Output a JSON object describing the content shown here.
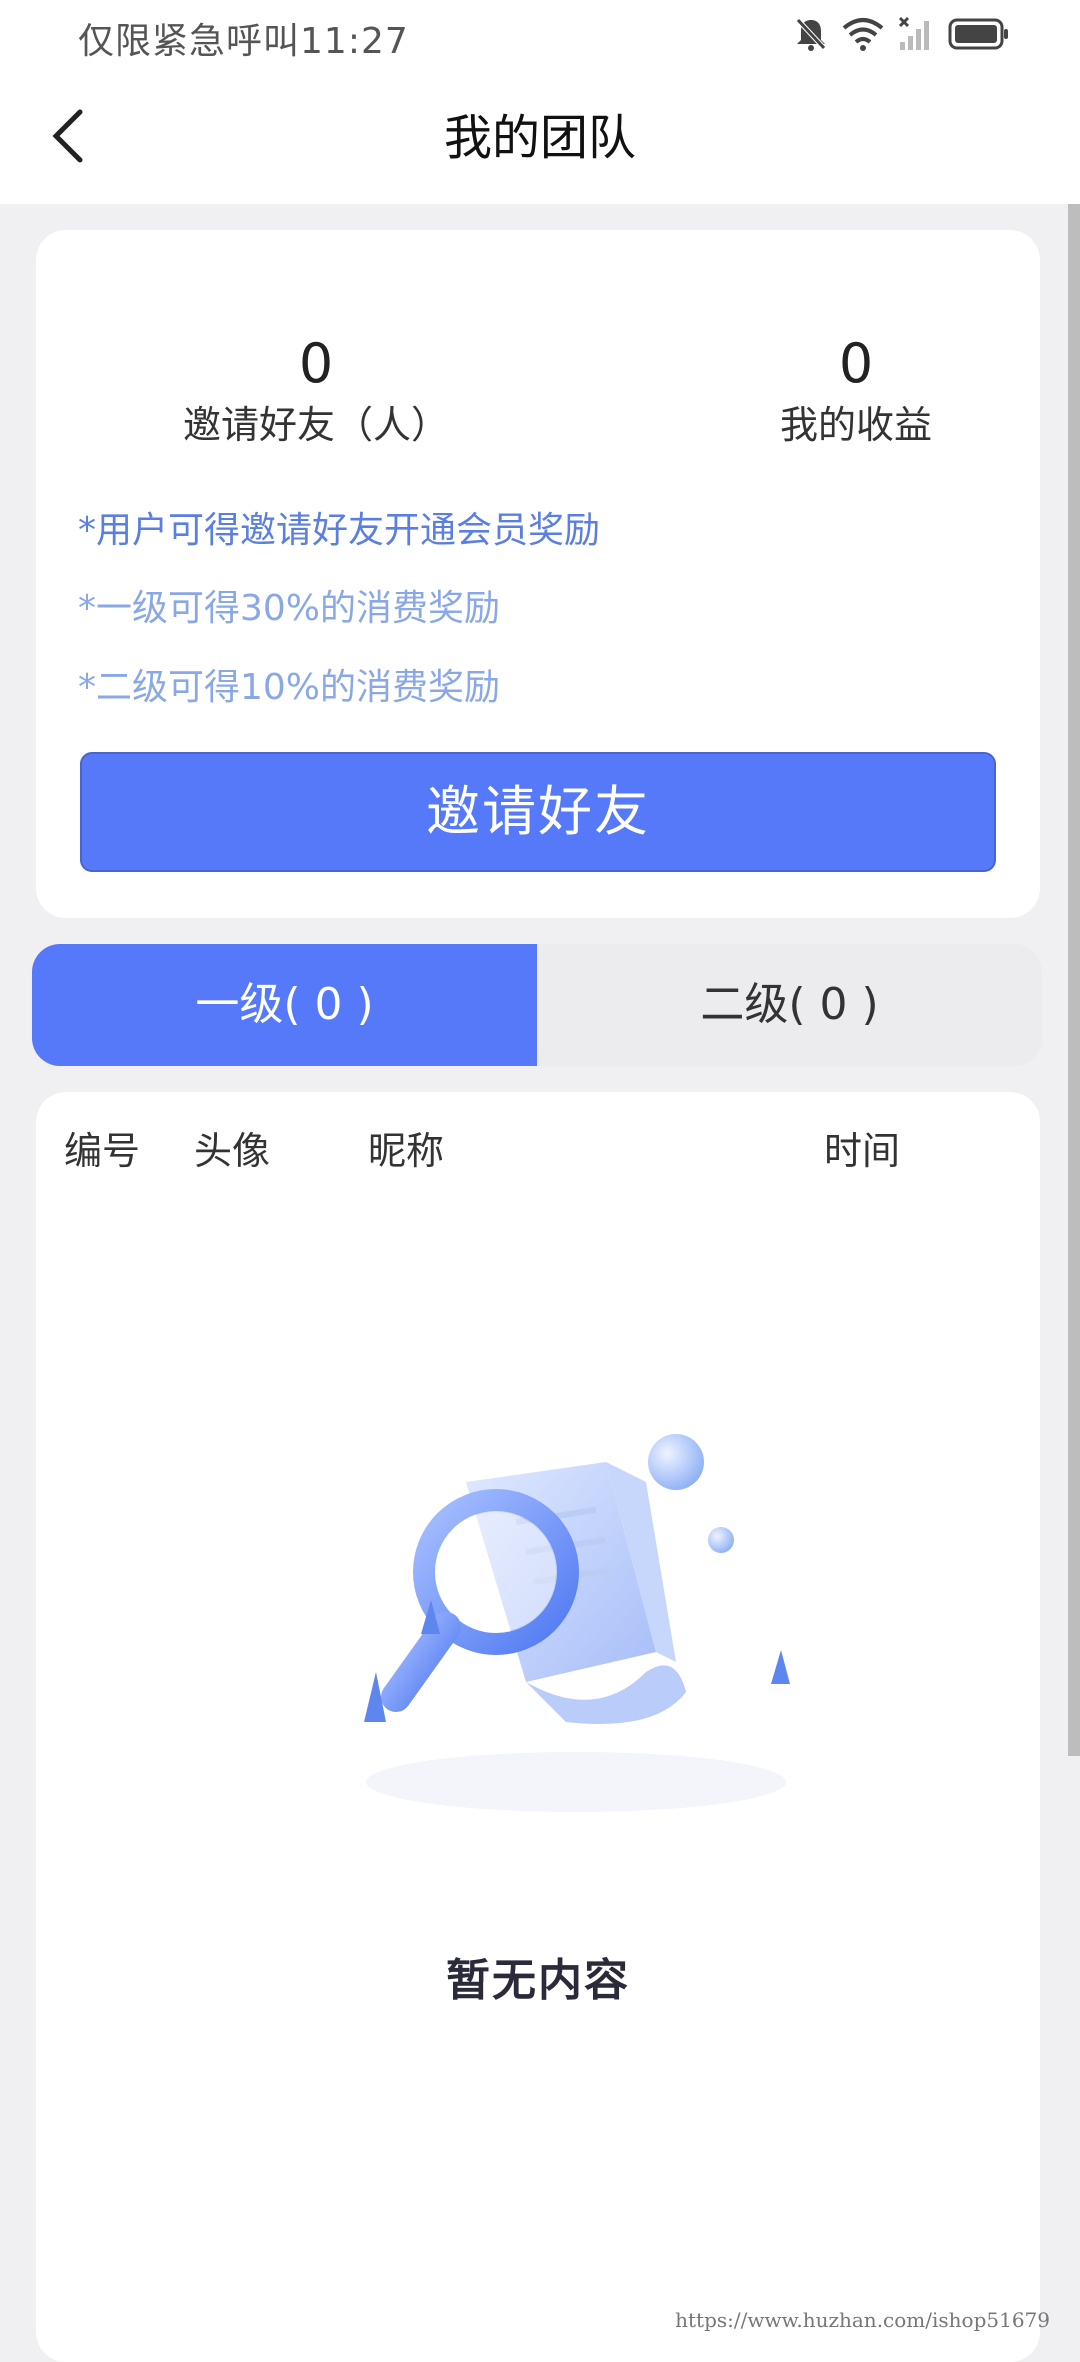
{
  "status_bar": {
    "carrier_text": "仅限紧急呼叫",
    "time": "11:27",
    "icons": [
      "bell-muted-icon",
      "wifi-icon",
      "signal-none-icon",
      "battery-icon"
    ]
  },
  "nav": {
    "title": "我的团队",
    "back_icon": "chevron-left-icon"
  },
  "stats": {
    "invited_value": "0",
    "invited_label": "邀请好友（人）",
    "earnings_value": "0",
    "earnings_label": "我的收益"
  },
  "notes": [
    "*用户可得邀请好友开通会员奖励",
    "*一级可得30%的消费奖励",
    "*二级可得10%的消费奖励"
  ],
  "invite_button_label": "邀请好友",
  "tabs": [
    {
      "label": "一级( 0 )",
      "active": true
    },
    {
      "label": "二级( 0 )",
      "active": false
    }
  ],
  "table": {
    "columns": [
      "编号",
      "头像",
      "昵称",
      "时间"
    ],
    "rows": []
  },
  "empty_state": {
    "icon": "magnifier-document-icon",
    "text": "暂无内容"
  },
  "watermark": "https://www.huzhan.com/ishop51679",
  "colors": {
    "accent": "#5579f8",
    "note_primary": "#5b7fe0",
    "note_secondary": "#8aa8e6",
    "background": "#f0f0f2"
  }
}
